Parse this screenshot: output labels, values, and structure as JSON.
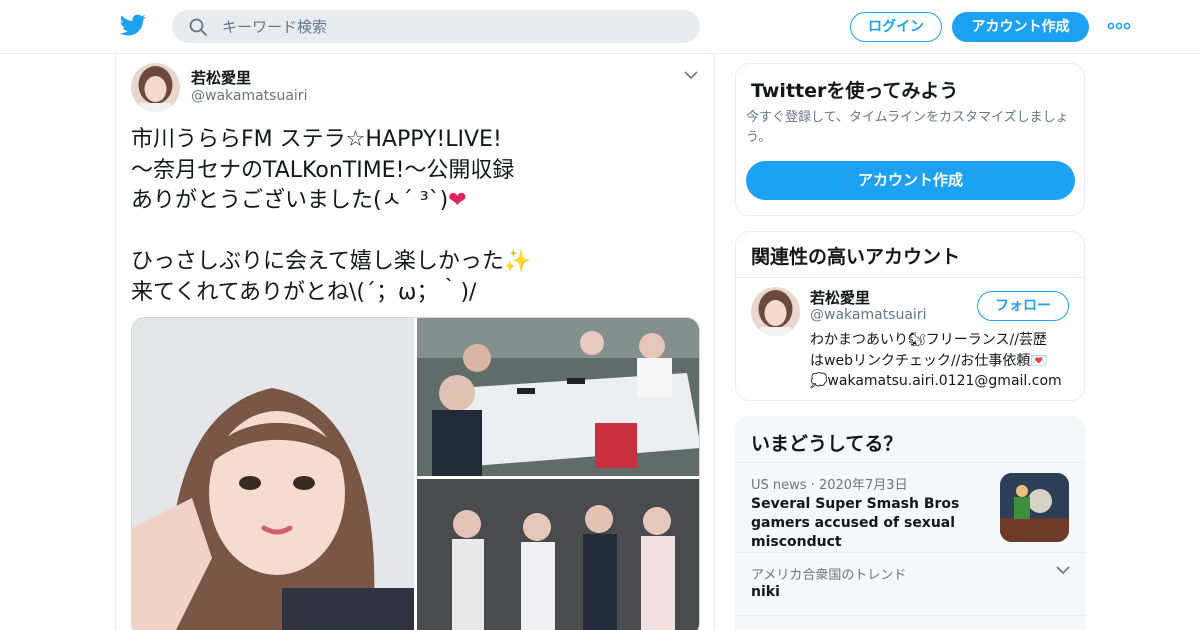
{
  "header": {
    "logo_icon": "twitter-bird-icon",
    "search_placeholder": "キーワード検索",
    "login_label": "ログイン",
    "signup_label": "アカウント作成",
    "more_icon": "more-dots-icon",
    "brand_color": "#1da1f2"
  },
  "tweet": {
    "author_name": "若松愛里",
    "author_handle": "@wakamatsuairi",
    "lines": [
      "市川うららFM ステラ☆HAPPY!LIVE!",
      "～奈月セナのTALKonTIME!～公開収録",
      "ありがとうございました(ㅅ´ ³`)",
      "",
      "ひっさしぶりに会えて嬉し楽しかった",
      "来てくれてありがとね\\(´；ω；｀)/"
    ],
    "line3_emoji": "❤",
    "line5_emoji": "✨",
    "caret_icon": "chevron-down-icon",
    "photos": [
      "photo-selfie",
      "photo-radio-booth",
      "photo-group"
    ]
  },
  "sidebar": {
    "signup_card": {
      "title": "Twitterを使ってみよう",
      "description": "今すぐ登録して、タイムラインをカスタマイズしましょう。",
      "button_label": "アカウント作成"
    },
    "related_card": {
      "title": "関連性の高いアカウント",
      "name": "若松愛里",
      "handle": "@wakamatsuairi",
      "follow_label": "フォロー",
      "bio_lines": [
        "わかまつあいり🐿フリーランス//芸歴",
        "はwebリンクチェック//お仕事依頼💌",
        "💭wakamatsu.airi.0121@gmail.com"
      ]
    },
    "trends_card": {
      "title": "いまどうしてる？",
      "items": [
        {
          "meta": "US news · 2020年7月3日",
          "title": "Several Super Smash Bros gamers accused of sexual misconduct"
        },
        {
          "meta": "アメリカ合衆国のトレンド",
          "title": "niki"
        }
      ]
    }
  }
}
